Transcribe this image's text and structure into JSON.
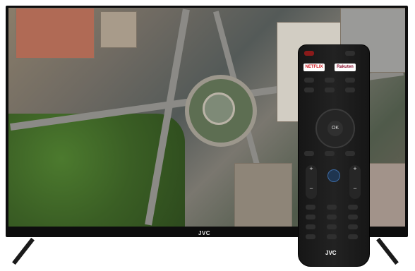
{
  "tv": {
    "brand_logo": "JVC",
    "screen_content": "city-aerial-view"
  },
  "remote": {
    "netflix_label": "NETFLIX",
    "rakuten_label": "Rakuten",
    "ok_label": "OK",
    "vol_plus": "+",
    "vol_minus": "−",
    "ch_plus": "+",
    "ch_minus": "−",
    "brand_logo": "JVC"
  }
}
